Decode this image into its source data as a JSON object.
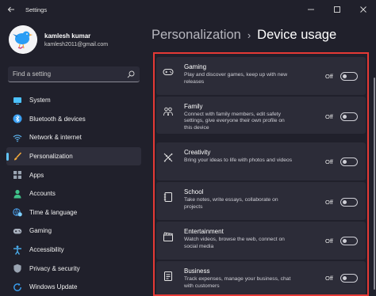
{
  "window": {
    "title": "Settings",
    "back_icon": "back-arrow-icon",
    "controls": [
      "minimize-icon",
      "maximize-icon",
      "close-icon"
    ]
  },
  "profile": {
    "name": "kamlesh kumar",
    "email": "kamlesh2011@gmail.com",
    "avatar_icon": "bird-avatar-icon"
  },
  "search": {
    "placeholder": "Find a setting"
  },
  "sidebar": {
    "items": [
      {
        "label": "System",
        "icon": "monitor-icon",
        "color": "#4cc2ff"
      },
      {
        "label": "Bluetooth & devices",
        "icon": "bluetooth-icon",
        "color": "#3aa0f3"
      },
      {
        "label": "Network & internet",
        "icon": "wifi-icon",
        "color": "#5fb8f5"
      },
      {
        "label": "Personalization",
        "icon": "brush-icon",
        "color": "#f2a93b",
        "active": true
      },
      {
        "label": "Apps",
        "icon": "apps-icon",
        "color": "#9aa4b2"
      },
      {
        "label": "Accounts",
        "icon": "person-icon",
        "color": "#3fc28a"
      },
      {
        "label": "Time & language",
        "icon": "globe-clock-icon",
        "color": "#4aa3f0"
      },
      {
        "label": "Gaming",
        "icon": "gamepad-icon",
        "color": "#aab2bf"
      },
      {
        "label": "Accessibility",
        "icon": "accessibility-icon",
        "color": "#4cb4f7"
      },
      {
        "label": "Privacy & security",
        "icon": "shield-icon",
        "color": "#9aa4b2"
      },
      {
        "label": "Windows Update",
        "icon": "update-icon",
        "color": "#3aa0f3"
      }
    ]
  },
  "breadcrumb": {
    "parent": "Personalization",
    "separator": "›",
    "current": "Device usage"
  },
  "options": [
    {
      "title": "Gaming",
      "desc": "Play and discover games, keep up with new releases",
      "state": "Off",
      "icon": "controller-icon"
    },
    {
      "title": "Family",
      "desc": "Connect with family members, edit safety settings, give everyone their own profile on this device",
      "state": "Off",
      "icon": "family-icon"
    },
    {
      "title": "Creativity",
      "desc": "Bring your ideas to life with photos and videos",
      "state": "Off",
      "icon": "pen-ruler-icon"
    },
    {
      "title": "School",
      "desc": "Take notes, write essays, collaborate on projects",
      "state": "Off",
      "icon": "notebook-icon"
    },
    {
      "title": "Entertainment",
      "desc": "Watch videos, browse the web, connect on social media",
      "state": "Off",
      "icon": "clapperboard-icon"
    },
    {
      "title": "Business",
      "desc": "Track expenses, manage your business, chat with customers",
      "state": "Off",
      "icon": "document-list-icon"
    }
  ],
  "colors": {
    "background": "#20202b",
    "card": "#2c2c38",
    "accent": "#60c3f5",
    "highlight_border": "#e53935"
  }
}
